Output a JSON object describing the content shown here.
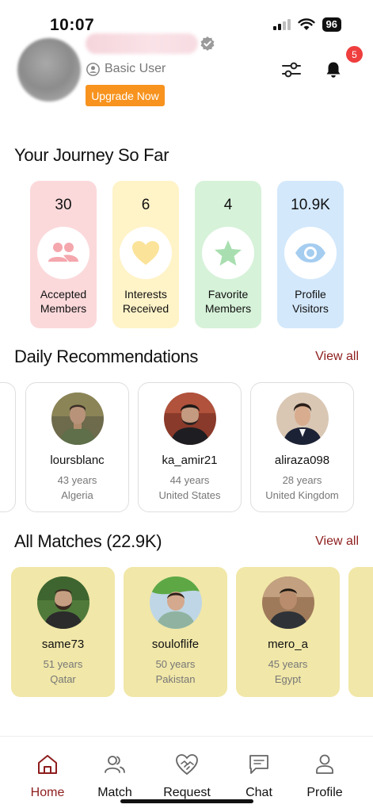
{
  "status_bar": {
    "time": "10:07",
    "battery": "96"
  },
  "header": {
    "user_type": "Basic User",
    "upgrade_label": "Upgrade Now",
    "notification_count": "5"
  },
  "journey": {
    "title": "Your Journey So Far",
    "cards": [
      {
        "count": "30",
        "label_line1": "Accepted",
        "label_line2": "Members",
        "icon": "people-icon",
        "color": "#fbd9db",
        "icon_color": "#f4a7ad"
      },
      {
        "count": "6",
        "label_line1": "Interests",
        "label_line2": "Received",
        "icon": "heart-icon",
        "color": "#fff3c8",
        "icon_color": "#fbe39a"
      },
      {
        "count": "4",
        "label_line1": "Favorite",
        "label_line2": "Members",
        "icon": "star-icon",
        "color": "#d6f2d9",
        "icon_color": "#a9dfb0"
      },
      {
        "count": "10.9K",
        "label_line1": "Profile",
        "label_line2": "Visitors",
        "icon": "eye-icon",
        "color": "#d3e8fb",
        "icon_color": "#a5cdf0"
      }
    ]
  },
  "recommendations": {
    "title": "Daily Recommendations",
    "view_all": "View all",
    "items": [
      {
        "name": "loursblanc",
        "age": "43 years",
        "country": "Algeria"
      },
      {
        "name": "ka_amir21",
        "age": "44 years",
        "country": "United States"
      },
      {
        "name": "aliraza098",
        "age": "28 years",
        "country": "United Kingdom"
      }
    ]
  },
  "matches": {
    "title": "All Matches (22.9K)",
    "view_all": "View all",
    "items": [
      {
        "name": "same73",
        "age": "51 years",
        "country": "Qatar"
      },
      {
        "name": "souloflife",
        "age": "50 years",
        "country": "Pakistan"
      },
      {
        "name": "mero_a",
        "age": "45 years",
        "country": "Egypt"
      }
    ]
  },
  "nav": {
    "items": [
      {
        "label": "Home",
        "icon": "home-icon",
        "active": true
      },
      {
        "label": "Match",
        "icon": "match-icon",
        "active": false
      },
      {
        "label": "Request",
        "icon": "request-icon",
        "active": false
      },
      {
        "label": "Chat",
        "icon": "chat-icon",
        "active": false
      },
      {
        "label": "Profile",
        "icon": "profile-icon",
        "active": false
      }
    ],
    "active_color": "#8e1d1d"
  },
  "colors": {
    "accent": "#8e1d1d",
    "upgrade": "#f7931e",
    "badge": "#ef3e3e",
    "match_card": "#f1e7a8"
  }
}
